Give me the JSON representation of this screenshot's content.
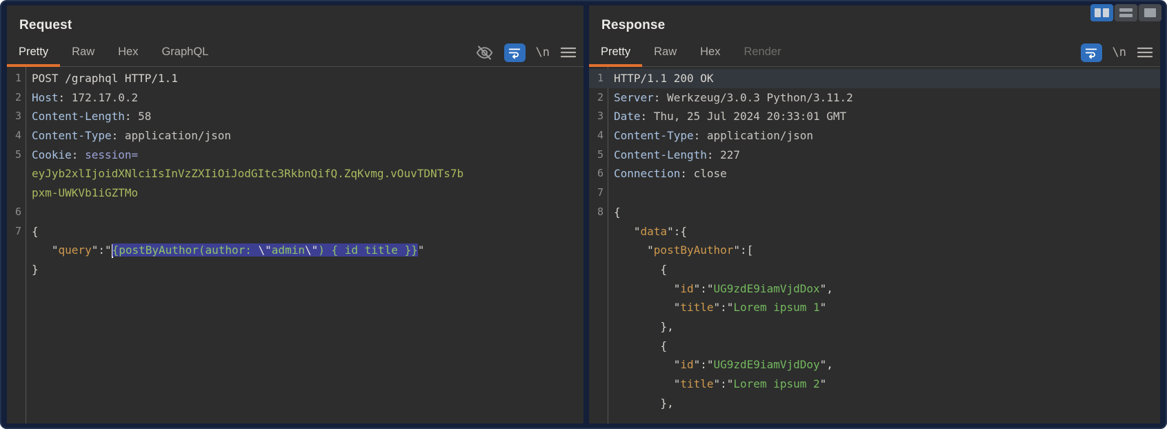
{
  "window": {
    "layout_buttons": [
      {
        "name": "layout-columns",
        "active": true
      },
      {
        "name": "layout-rows",
        "active": false
      },
      {
        "name": "layout-single",
        "active": false
      }
    ],
    "accent_orange": "#e0702f",
    "accent_blue": "#2f6fbd",
    "selection_color": "#3d3f92"
  },
  "icons": {
    "newline_label": "\\n"
  },
  "request": {
    "title": "Request",
    "tabs": [
      {
        "label": "Pretty",
        "active": true
      },
      {
        "label": "Raw"
      },
      {
        "label": "Hex"
      },
      {
        "label": "GraphQL"
      }
    ],
    "toolbar": [
      "visibility-off",
      "word-wrap",
      "newline",
      "menu"
    ],
    "lines": [
      {
        "n": "1",
        "seg": [
          [
            "p",
            "POST /graphql HTTP/1.1"
          ]
        ]
      },
      {
        "n": "2",
        "seg": [
          [
            "n",
            "Host"
          ],
          [
            "p",
            ": "
          ],
          [
            "v",
            "172.17.0.2"
          ]
        ]
      },
      {
        "n": "3",
        "seg": [
          [
            "n",
            "Content-Length"
          ],
          [
            "p",
            ": "
          ],
          [
            "v",
            "58"
          ]
        ]
      },
      {
        "n": "4",
        "seg": [
          [
            "n",
            "Content-Type"
          ],
          [
            "p",
            ": "
          ],
          [
            "v",
            "application/json"
          ]
        ]
      },
      {
        "n": "5",
        "seg": [
          [
            "n",
            "Cookie"
          ],
          [
            "p",
            ": "
          ],
          [
            "l",
            "session="
          ]
        ]
      },
      {
        "n": "",
        "seg": [
          [
            "ck",
            "eyJyb2xlIjoidXNlciIsInVzZXIiOiJodGItc3RkbnQifQ.ZqKvmg.vOuvTDNTs7b"
          ]
        ]
      },
      {
        "n": "",
        "seg": [
          [
            "ck",
            "pxm-UWKVb1iGZTMo"
          ]
        ]
      },
      {
        "n": "6",
        "seg": []
      },
      {
        "n": "7",
        "seg": [
          [
            "p",
            "{"
          ]
        ]
      },
      {
        "n": "",
        "seg": [
          [
            "p",
            "   \""
          ],
          [
            "k",
            "query"
          ],
          [
            "p",
            "\":\""
          ],
          [
            "caret",
            ""
          ],
          [
            "sg",
            "{postByAuthor(author: "
          ],
          [
            "sw",
            "\\\""
          ],
          [
            "sg",
            "admin"
          ],
          [
            "sw",
            "\\\""
          ],
          [
            "sg",
            ") { id title }}"
          ],
          [
            "p",
            "\""
          ]
        ]
      },
      {
        "n": "",
        "seg": [
          [
            "p",
            "}"
          ]
        ]
      }
    ]
  },
  "response": {
    "title": "Response",
    "tabs": [
      {
        "label": "Pretty",
        "active": true
      },
      {
        "label": "Raw"
      },
      {
        "label": "Hex"
      },
      {
        "label": "Render",
        "disabled": true
      }
    ],
    "toolbar": [
      "word-wrap",
      "newline",
      "menu"
    ],
    "lines": [
      {
        "n": "1",
        "hl": true,
        "seg": [
          [
            "p",
            "HTTP/1.1 200 OK"
          ]
        ]
      },
      {
        "n": "2",
        "seg": [
          [
            "n",
            "Server"
          ],
          [
            "p",
            ": "
          ],
          [
            "v",
            "Werkzeug/3.0.3 Python/3.11.2"
          ]
        ]
      },
      {
        "n": "3",
        "seg": [
          [
            "n",
            "Date"
          ],
          [
            "p",
            ": "
          ],
          [
            "v",
            "Thu, 25 Jul 2024 20:33:01 GMT"
          ]
        ]
      },
      {
        "n": "4",
        "seg": [
          [
            "n",
            "Content-Type"
          ],
          [
            "p",
            ": "
          ],
          [
            "v",
            "application/json"
          ]
        ]
      },
      {
        "n": "5",
        "seg": [
          [
            "n",
            "Content-Length"
          ],
          [
            "p",
            ": "
          ],
          [
            "v",
            "227"
          ]
        ]
      },
      {
        "n": "6",
        "seg": [
          [
            "n",
            "Connection"
          ],
          [
            "p",
            ": "
          ],
          [
            "v",
            "close"
          ]
        ]
      },
      {
        "n": "7",
        "seg": []
      },
      {
        "n": "8",
        "seg": [
          [
            "p",
            "{"
          ]
        ]
      },
      {
        "n": "",
        "seg": [
          [
            "p",
            "   \""
          ],
          [
            "k",
            "data"
          ],
          [
            "p",
            "\":{"
          ]
        ]
      },
      {
        "n": "",
        "seg": [
          [
            "p",
            "     \""
          ],
          [
            "k",
            "postByAuthor"
          ],
          [
            "p",
            "\":["
          ]
        ]
      },
      {
        "n": "",
        "seg": [
          [
            "p",
            "       {"
          ]
        ]
      },
      {
        "n": "",
        "seg": [
          [
            "p",
            "         \""
          ],
          [
            "k",
            "id"
          ],
          [
            "p",
            "\":\""
          ],
          [
            "s",
            "UG9zdE9iamVjdDox"
          ],
          [
            "p",
            "\","
          ]
        ]
      },
      {
        "n": "",
        "seg": [
          [
            "p",
            "         \""
          ],
          [
            "k",
            "title"
          ],
          [
            "p",
            "\":\""
          ],
          [
            "s",
            "Lorem ipsum 1"
          ],
          [
            "p",
            "\""
          ]
        ]
      },
      {
        "n": "",
        "seg": [
          [
            "p",
            "       },"
          ]
        ]
      },
      {
        "n": "",
        "seg": [
          [
            "p",
            "       {"
          ]
        ]
      },
      {
        "n": "",
        "seg": [
          [
            "p",
            "         \""
          ],
          [
            "k",
            "id"
          ],
          [
            "p",
            "\":\""
          ],
          [
            "s",
            "UG9zdE9iamVjdDoy"
          ],
          [
            "p",
            "\","
          ]
        ]
      },
      {
        "n": "",
        "seg": [
          [
            "p",
            "         \""
          ],
          [
            "k",
            "title"
          ],
          [
            "p",
            "\":\""
          ],
          [
            "s",
            "Lorem ipsum 2"
          ],
          [
            "p",
            "\""
          ]
        ]
      },
      {
        "n": "",
        "seg": [
          [
            "p",
            "       },"
          ]
        ]
      }
    ]
  }
}
